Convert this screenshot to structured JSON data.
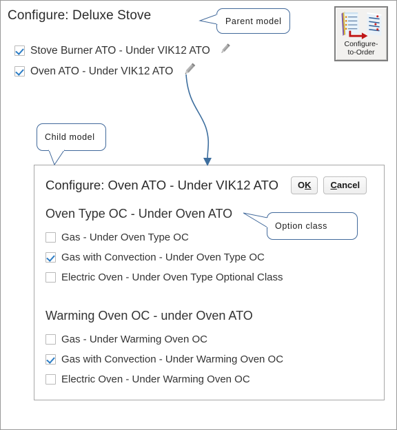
{
  "page": {
    "title": "Configure: Deluxe Stove"
  },
  "parent_items": [
    {
      "label": "Stove Burner ATO - Under VIK12 ATO",
      "checked": true,
      "pencil": true
    },
    {
      "label": "Oven ATO - Under VIK12 ATO",
      "checked": true,
      "pencil": true
    }
  ],
  "cto_button": {
    "line1": "Configure-",
    "line2": "to-Order"
  },
  "callouts": {
    "parent": "Parent model",
    "child": "Child model",
    "option": "Option class"
  },
  "dialog": {
    "title": "Configure: Oven ATO - Under VIK12 ATO",
    "ok_label": "OK",
    "ok_mnemonic": "K",
    "cancel_label": "Cancel",
    "cancel_mnemonic": "C",
    "groups": [
      {
        "title": "Oven Type OC - Under Oven ATO",
        "options": [
          {
            "label": "Gas - Under Oven Type OC",
            "checked": false
          },
          {
            "label": "Gas with Convection - Under Oven Type OC",
            "checked": true
          },
          {
            "label": "Electric Oven - Under Oven Type Optional Class",
            "checked": false
          }
        ]
      },
      {
        "title": "Warming Oven OC - under Oven ATO",
        "options": [
          {
            "label": "Gas - Under Warming Oven OC",
            "checked": false
          },
          {
            "label": "Gas with Convection - Under Warming Oven OC",
            "checked": true
          },
          {
            "label": "Electric Oven - Under Warming Oven OC",
            "checked": false
          }
        ]
      }
    ]
  },
  "colors": {
    "checkmark": "#2b7cc4",
    "callout_border": "#41699b",
    "arrow": "#3d6e9e",
    "pencil": "#9a9a9a",
    "text": "#333333"
  }
}
